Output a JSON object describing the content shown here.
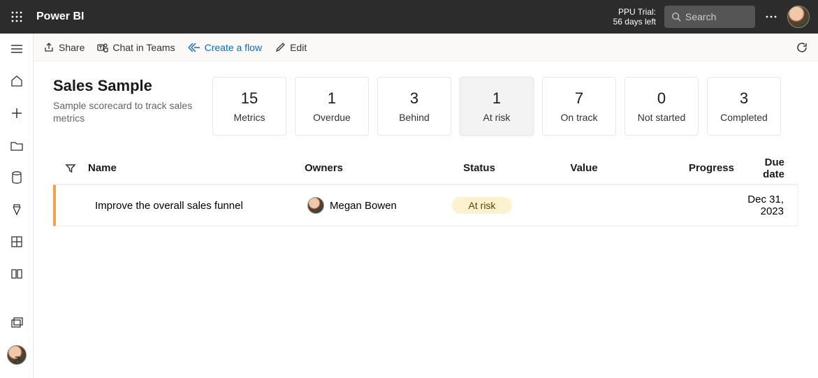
{
  "topbar": {
    "app_title": "Power BI",
    "trial_line1": "PPU Trial:",
    "trial_line2": "56 days left",
    "search_placeholder": "Search"
  },
  "cmdbar": {
    "share": "Share",
    "chat": "Chat in Teams",
    "flow": "Create a flow",
    "edit": "Edit"
  },
  "page": {
    "title": "Sales Sample",
    "subtitle": "Sample scorecard to track sales metrics"
  },
  "cards": [
    {
      "value": "15",
      "label": "Metrics",
      "selected": false
    },
    {
      "value": "1",
      "label": "Overdue",
      "selected": false
    },
    {
      "value": "3",
      "label": "Behind",
      "selected": false
    },
    {
      "value": "1",
      "label": "At risk",
      "selected": true
    },
    {
      "value": "7",
      "label": "On track",
      "selected": false
    },
    {
      "value": "0",
      "label": "Not started",
      "selected": false
    },
    {
      "value": "3",
      "label": "Completed",
      "selected": false
    }
  ],
  "columns": {
    "name": "Name",
    "owners": "Owners",
    "status": "Status",
    "value": "Value",
    "progress": "Progress",
    "due": "Due date"
  },
  "rows": [
    {
      "name": "Improve the overall sales funnel",
      "owner": "Megan Bowen",
      "status": "At risk",
      "value": "",
      "progress": "",
      "due": "Dec 31, 2023",
      "accent_color": "#f7a048",
      "status_bg": "#fdf2cf"
    }
  ]
}
